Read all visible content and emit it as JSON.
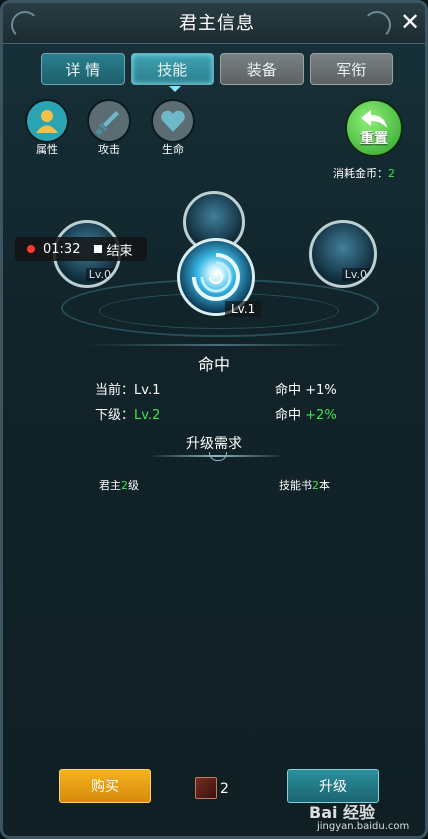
{
  "window": {
    "title": "君主信息"
  },
  "tabs": [
    {
      "label": "详 情",
      "state": "blue"
    },
    {
      "label": "技能",
      "state": "active"
    },
    {
      "label": "装备",
      "state": "gray"
    },
    {
      "label": "军衔",
      "state": "gray"
    }
  ],
  "categories": [
    {
      "label": "属性",
      "icon": "person-icon",
      "active": true
    },
    {
      "label": "攻击",
      "icon": "sword-icon",
      "active": false
    },
    {
      "label": "生命",
      "icon": "heart-icon",
      "active": false
    }
  ],
  "reset": {
    "label": "重置",
    "cost_label": "消耗金币：",
    "cost_value": "2"
  },
  "recording": {
    "time": "01:32",
    "stop_label": "结束"
  },
  "skills": {
    "left": {
      "level": "Lv.0"
    },
    "top": {
      "level": ""
    },
    "center": {
      "level": "Lv.1"
    },
    "right": {
      "level": "Lv.0"
    }
  },
  "selected_skill": {
    "name": "命中",
    "current_label": "当前：",
    "current_level": "Lv.1",
    "current_effect_label": "命中",
    "current_effect_value": "+1%",
    "next_label": "下级：",
    "next_level": "Lv.2",
    "next_effect_label": "命中",
    "next_effect_value": "+2%"
  },
  "requirements": {
    "title": "升级需求",
    "lord_prefix": "君主",
    "lord_value": "2",
    "lord_suffix": "级",
    "book_prefix": "技能书",
    "book_value": "2",
    "book_suffix": "本"
  },
  "footer": {
    "buy_label": "购买",
    "book_count": "2",
    "upgrade_label": "升级"
  },
  "watermark": {
    "brand": "Bai 经验",
    "url": "jingyan.baidu.com"
  },
  "colors": {
    "accent": "#2aa3b3",
    "green": "#3de64d",
    "buy": "#f5b21f"
  }
}
